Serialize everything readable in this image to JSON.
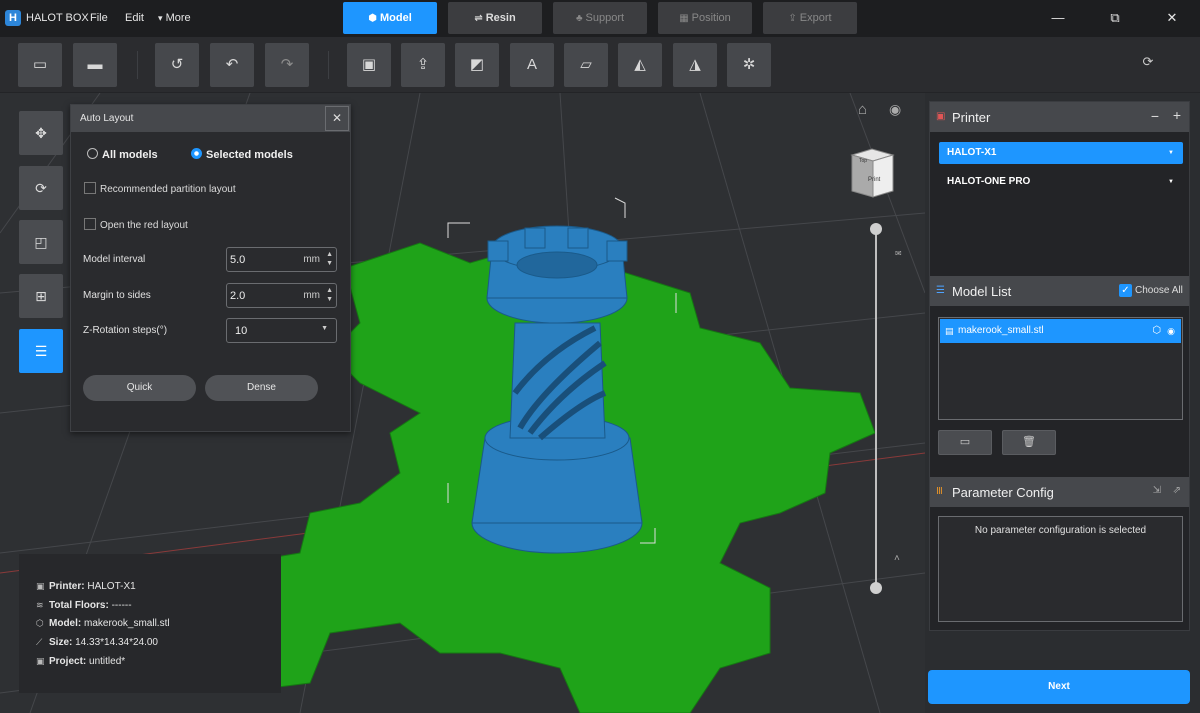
{
  "titlebar": {
    "app_name": "HALOT BOX",
    "menu": [
      "File",
      "Edit",
      "More"
    ],
    "more_caret": "▾",
    "steps": [
      {
        "label": "Model",
        "glyph": "⬢"
      },
      {
        "label": "Resin",
        "glyph": "⇌"
      },
      {
        "label": "Support",
        "glyph": "♣"
      },
      {
        "label": "Position",
        "glyph": "▦"
      },
      {
        "label": "Export",
        "glyph": "⇪"
      }
    ],
    "window": {
      "minimize": "—",
      "restore": "⧉",
      "close": "✕"
    }
  },
  "toolbar": {
    "icons": [
      "open-file-icon",
      "import-icon",
      "history-icon",
      "undo-icon",
      "redo-icon",
      "print-icon",
      "export-icon",
      "slice-icon",
      "text-icon",
      "ruler-icon",
      "eraser-icon",
      "mirror-icon",
      "settings-icon",
      "loading-icon"
    ]
  },
  "left_tools": [
    "move-icon",
    "rotate-icon",
    "scale-icon",
    "add-icon",
    "layout-icon"
  ],
  "auto_layout": {
    "title": "Auto Layout",
    "close": "✕",
    "radio_all": "All models",
    "radio_selected": "Selected models",
    "selected_mode": "selected",
    "check_partition": "Recommended partition layout",
    "check_red": "Open the red layout",
    "interval_label": "Model interval",
    "interval_value": "5.0",
    "interval_unit": "mm",
    "margin_label": "Margin to sides",
    "margin_value": "2.0",
    "margin_unit": "mm",
    "zrot_label": "Z-Rotation steps(°)",
    "zrot_value": "10",
    "quick": "Quick",
    "dense": "Dense"
  },
  "viewport": {
    "cube_top": "Top",
    "cube_front": "Print",
    "plate_color": "#1fa319",
    "model_color": "#2a7fbf"
  },
  "printer": {
    "title": "Printer",
    "minus": "−",
    "plus": "+",
    "selected": "HALOT-X1",
    "other": "HALOT-ONE PRO"
  },
  "model_list": {
    "title": "Model List",
    "choose_all": "Choose All",
    "items": [
      "makerook_small.stl"
    ]
  },
  "param_config": {
    "title": "Parameter Config",
    "empty": "No parameter configuration is selected"
  },
  "next": "Next",
  "info": {
    "printer_label": "Printer:",
    "printer_value": "HALOT-X1",
    "floors_label": "Total Floors:",
    "floors_value": "------",
    "model_label": "Model:",
    "model_value": "makerook_small.stl",
    "size_label": "Size:",
    "size_value": "14.33*14.34*24.00",
    "project_label": "Project:",
    "project_value": "untitled*"
  }
}
